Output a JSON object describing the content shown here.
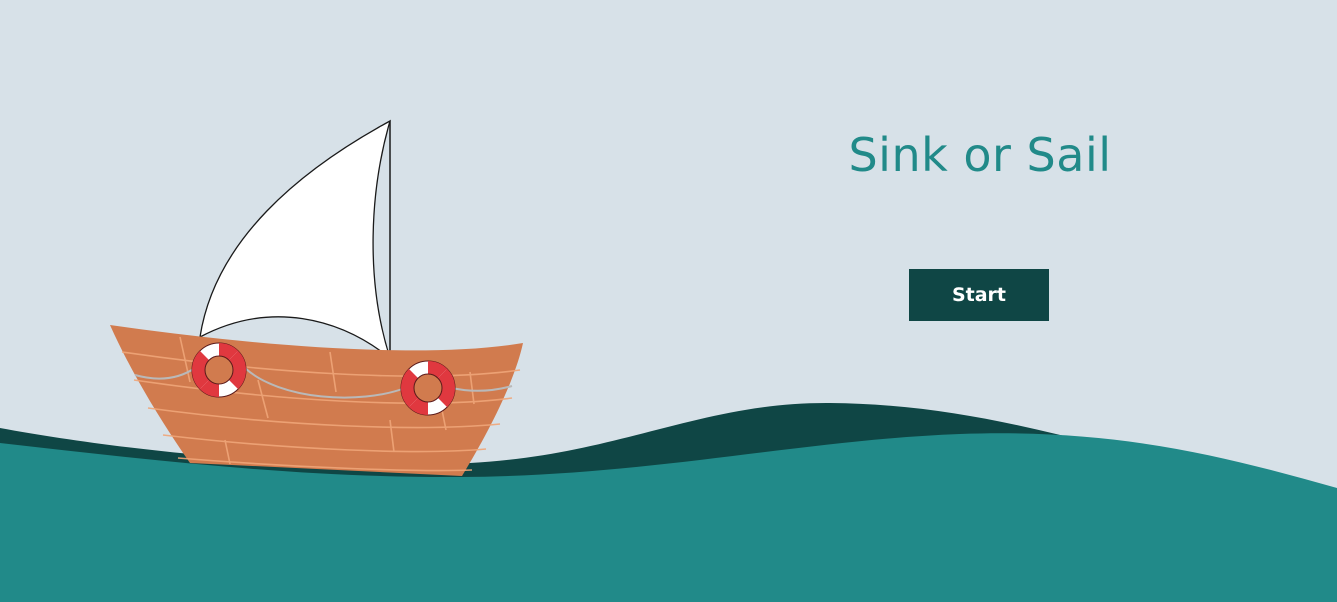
{
  "game": {
    "title": "Sink or Sail",
    "start_label": "Start"
  },
  "colors": {
    "background": "#d7e1e8",
    "title": "#218a89",
    "button": "#0f4645",
    "button_text": "#ffffff",
    "wave_front": "#218a89",
    "wave_back": "#0f4645",
    "hull": "#d17b4e",
    "hull_plank_lines": "#f0a679",
    "sail": "#ffffff",
    "lifebuoy_red": "#e0383f",
    "lifebuoy_white": "#ffffff"
  },
  "icons": [
    "sailboat-icon",
    "lifebuoy-icon"
  ]
}
